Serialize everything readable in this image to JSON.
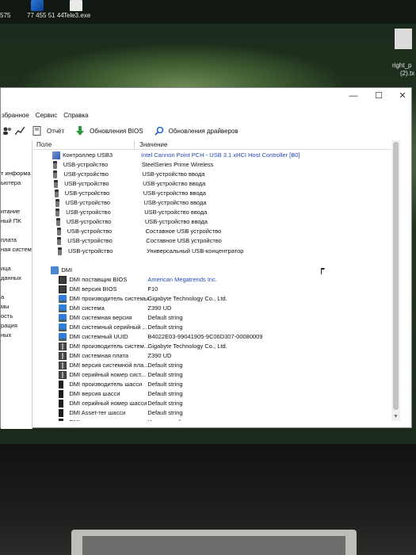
{
  "desktop": {
    "icon_label_1": "575",
    "icon_label_2": "77 455 51 44",
    "icon_label_3": "Tele3.exe",
    "right_file_label_1": "right_p",
    "right_file_label_2": "(2).tx"
  },
  "window": {
    "controls": {
      "minimize": "—",
      "maximize": "☐",
      "close": "✕"
    },
    "menu": [
      "збранное",
      "Сервис",
      "Справка"
    ],
    "toolbar": {
      "report": "Отчёт",
      "bios_update": "Обновления BIOS",
      "driver_update": "Обновления драйверов"
    },
    "sidebar": [
      "",
      "",
      "",
      "т информа",
      "ьютера",
      "",
      "",
      "итание",
      "ный ПК",
      "",
      "плата",
      "ная система",
      "",
      "ица",
      "данных",
      "",
      "а",
      "мы",
      "ость",
      "рация",
      "ных"
    ],
    "columns": {
      "field": "Поле",
      "value": "Значение"
    },
    "rows": [
      {
        "icon": "usb-controller-icon",
        "field": "Контроллер USB3",
        "value": "Intel Cannon Point PCH - USB 3.1 xHCI Host Controller [B0]",
        "link": true
      },
      {
        "icon": "usb-plug-icon",
        "field": "USB-устройство",
        "value": "SteelSeries Prime Wireless"
      },
      {
        "icon": "usb-plug-icon",
        "field": "USB-устройство",
        "value": "USB-устройство ввода"
      },
      {
        "icon": "usb-plug-icon",
        "field": "USB-устройство",
        "value": "USB-устройство ввода"
      },
      {
        "icon": "usb-plug-icon",
        "field": "USB-устройство",
        "value": "USB-устройство ввода"
      },
      {
        "icon": "usb-plug-icon",
        "field": "USB-устройство",
        "value": "USB-устройство ввода"
      },
      {
        "icon": "usb-plug-icon",
        "field": "USB-устройство",
        "value": "USB-устройство ввода"
      },
      {
        "icon": "usb-plug-icon",
        "field": "USB-устройство",
        "value": "USB-устройство ввода"
      },
      {
        "icon": "usb-plug-icon",
        "field": "USB-устройство",
        "value": "Составное USB устройство"
      },
      {
        "icon": "usb-plug-icon",
        "field": "USB-устройство",
        "value": "Составное USB устройство"
      },
      {
        "icon": "usb-plug-icon",
        "field": "USB-устройство",
        "value": "Универсальный USB-концентратор"
      },
      {
        "icon": "",
        "field": "",
        "value": ""
      },
      {
        "icon": "dmi-folder-icon",
        "field": "DMI",
        "value": "",
        "group": true
      },
      {
        "icon": "chip-icon",
        "field": "DMI поставщик BIOS",
        "value": "American Megatrends Inc.",
        "link": true
      },
      {
        "icon": "chip-icon",
        "field": "DMI версия BIOS",
        "value": "F10"
      },
      {
        "icon": "monitor-icon",
        "field": "DMI производитель системы",
        "value": "Gigabyte Technology Co., Ltd."
      },
      {
        "icon": "monitor-icon",
        "field": "DMI система",
        "value": "Z390 UD"
      },
      {
        "icon": "monitor-icon",
        "field": "DMI системная версия",
        "value": "Default string"
      },
      {
        "icon": "monitor-icon",
        "field": "DMI системный серийный ...",
        "value": "Default string"
      },
      {
        "icon": "monitor-icon",
        "field": "DMI системный UUID",
        "value": "B4022E03-99041905-9C06D307-00080009"
      },
      {
        "icon": "motherboard-icon",
        "field": "DMI производитель систем...",
        "value": "Gigabyte Technology Co., Ltd."
      },
      {
        "icon": "motherboard-icon",
        "field": "DMI системная плата",
        "value": "Z390 UD"
      },
      {
        "icon": "motherboard-icon",
        "field": "DMI версия системной пла...",
        "value": "Default string"
      },
      {
        "icon": "motherboard-icon",
        "field": "DMI серийный номер сист...",
        "value": "Default string"
      },
      {
        "icon": "chassis-icon",
        "field": "DMI производитель шасси",
        "value": "Default string"
      },
      {
        "icon": "chassis-icon",
        "field": "DMI версия шасси",
        "value": "Default string"
      },
      {
        "icon": "chassis-icon",
        "field": "DMI серийный номер шасси",
        "value": "Default string"
      },
      {
        "icon": "chassis-icon",
        "field": "DMI Asset-тег шасси",
        "value": "Default string"
      },
      {
        "icon": "chassis-icon",
        "field": "DMI тип шасси",
        "value": "Настольный"
      }
    ]
  }
}
